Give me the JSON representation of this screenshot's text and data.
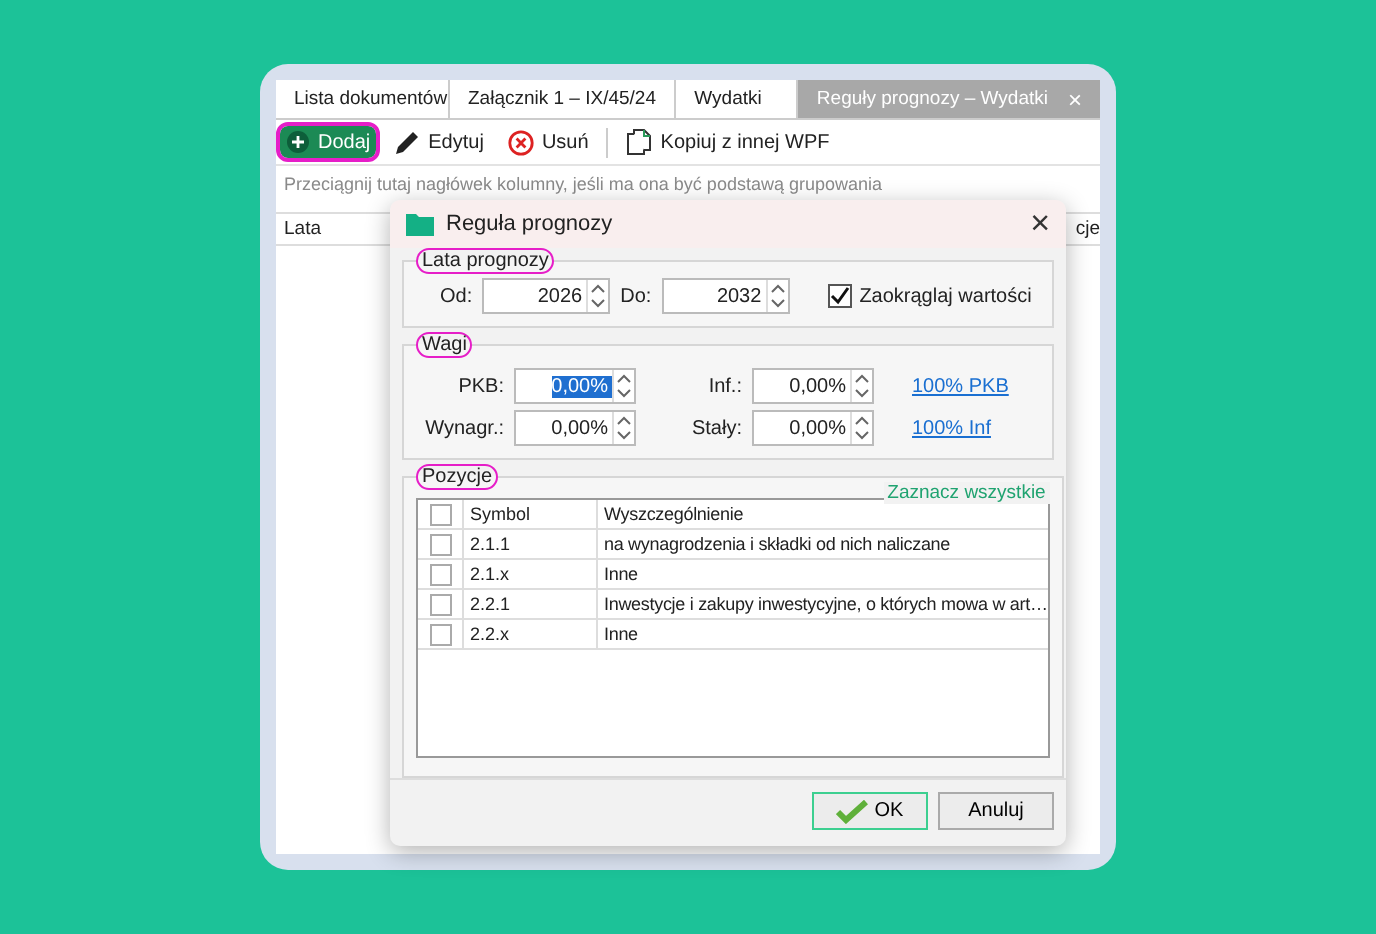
{
  "tabs": [
    {
      "label": "Lista dokumentów",
      "selected": false,
      "closable": false
    },
    {
      "label": "Załącznik 1 – IX/45/24",
      "selected": false,
      "closable": false
    },
    {
      "label": "Wydatki",
      "selected": false,
      "closable": false
    },
    {
      "label": "Reguły prognozy – Wydatki",
      "selected": true,
      "closable": true,
      "close": "×"
    }
  ],
  "toolbar": [
    {
      "kind": "add",
      "label": "Dodaj",
      "highlighted": true
    },
    {
      "kind": "edit",
      "label": "Edytuj",
      "highlighted": false
    },
    {
      "kind": "delete",
      "label": "Usuń",
      "highlighted": false
    },
    {
      "kind": "copy",
      "label": "Kopiuj z innej WPF",
      "highlighted": false
    }
  ],
  "grid": {
    "group_hint": "Przeciągnij tutaj nagłówek kolumny, jeśli ma ona być podstawą grupowania",
    "columns": [
      "Lata",
      "cje"
    ]
  },
  "dialog": {
    "title": "Reguła prognozy",
    "close": "×",
    "years": {
      "legend": "Lata prognozy",
      "highlighted": true,
      "fields": [
        {
          "label": "Od:",
          "value": "2026",
          "text_selected": false
        },
        {
          "label": "Do:",
          "value": "2032",
          "text_selected": false
        }
      ],
      "round": {
        "label": "Zaokrąglaj wartości",
        "checked": true
      }
    },
    "weights": {
      "legend": "Wagi",
      "highlighted": true,
      "rows": [
        {
          "fields": [
            {
              "label": "PKB:",
              "value": "0,00%",
              "text_selected": true
            },
            {
              "label": "Inf.:",
              "value": "0,00%",
              "text_selected": false
            }
          ],
          "link": "100% PKB"
        },
        {
          "fields": [
            {
              "label": "Wynagr.:",
              "value": "0,00%",
              "text_selected": false
            },
            {
              "label": "Stały:",
              "value": "0,00%",
              "text_selected": false
            }
          ],
          "link": "100% Inf"
        }
      ]
    },
    "positions": {
      "legend": "Pozycje",
      "highlighted": true,
      "select_all": "Zaznacz wszystkie",
      "header": {
        "checked": false,
        "columns": [
          "Symbol",
          "Wyszczególnienie"
        ]
      },
      "rows": [
        {
          "symbol": "2.1.1",
          "description": "na wynagrodzenia i składki od nich naliczane",
          "checked": false
        },
        {
          "symbol": "2.1.x",
          "description": "Inne",
          "checked": false
        },
        {
          "symbol": "2.2.1",
          "description": "Inwestycje i zakupy inwestycyjne, o których mowa w art…",
          "checked": false
        },
        {
          "symbol": "2.2.x",
          "description": "Inne",
          "checked": false
        }
      ]
    },
    "buttons": [
      {
        "kind": "ok",
        "label": "OK"
      },
      {
        "kind": "cancel",
        "label": "Anuluj"
      }
    ]
  }
}
